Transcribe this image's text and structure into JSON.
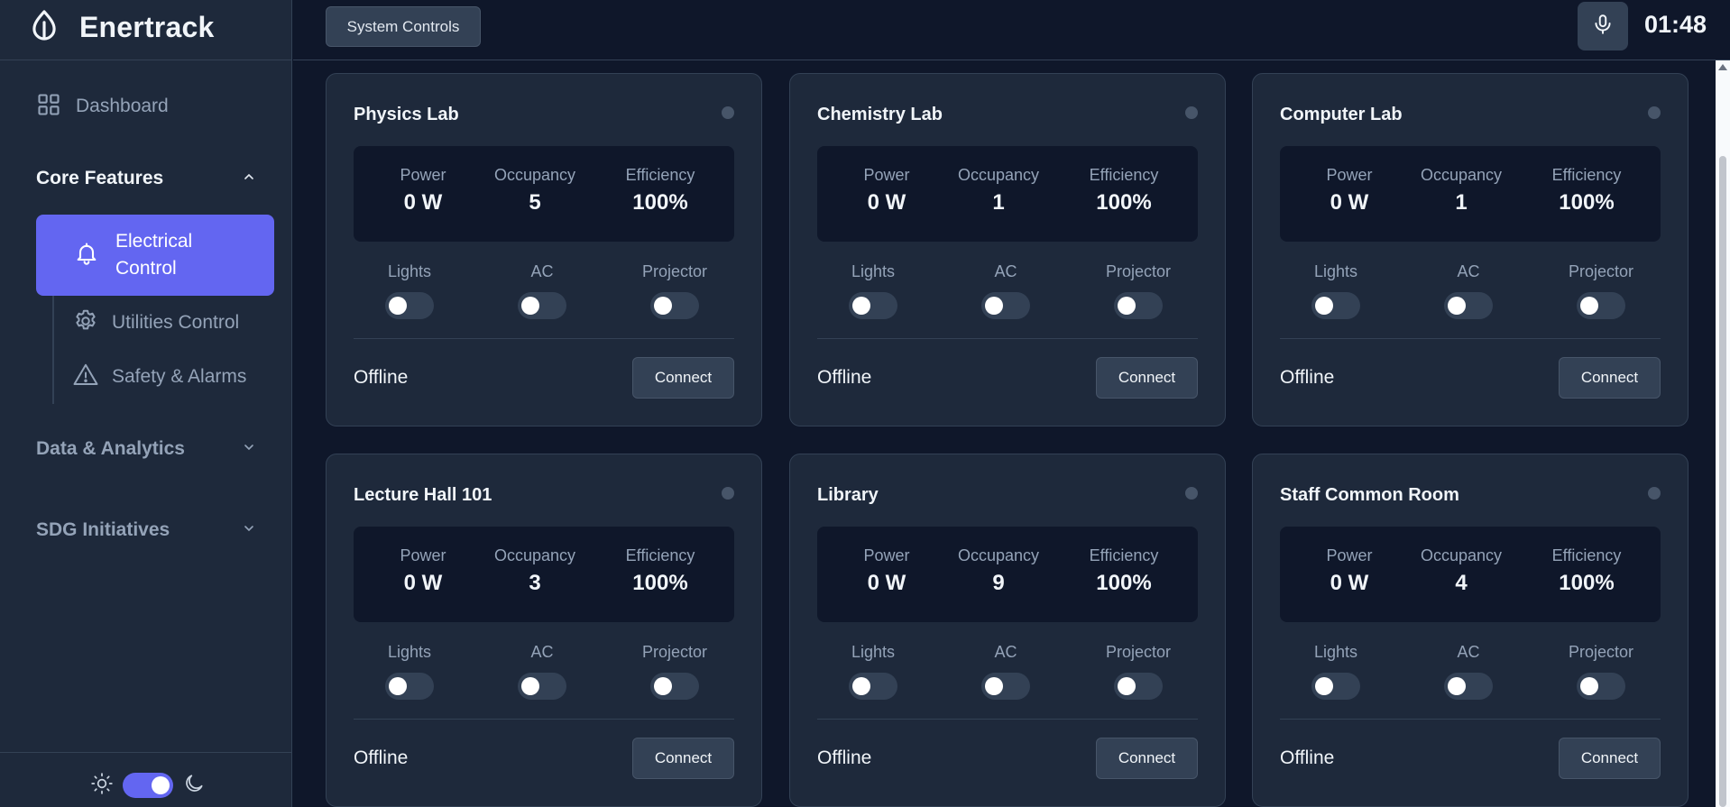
{
  "app": {
    "name": "Enertrack",
    "logo_icon": "leaf-drop-icon"
  },
  "sidebar": {
    "dashboard_label": "Dashboard",
    "core_features": {
      "label": "Core Features",
      "items": [
        {
          "label": "Electrical Control",
          "icon": "bell-icon",
          "active": true
        },
        {
          "label": "Utilities Control",
          "icon": "gear-icon"
        },
        {
          "label": "Safety & Alarms",
          "icon": "warning-icon"
        }
      ]
    },
    "data_analytics_label": "Data & Analytics",
    "sdg_label": "SDG Initiatives",
    "theme": {
      "dark_mode": true
    }
  },
  "topbar": {
    "system_controls_label": "System Controls",
    "clock": "01:48"
  },
  "labels": {
    "power": "Power",
    "occupancy": "Occupancy",
    "efficiency": "Efficiency",
    "lights": "Lights",
    "ac": "AC",
    "projector": "Projector",
    "connect": "Connect"
  },
  "rooms": [
    {
      "name": "Physics Lab",
      "power": "0 W",
      "occupancy": "5",
      "efficiency": "100%",
      "status": "Offline",
      "lights": false,
      "ac": false,
      "projector": false
    },
    {
      "name": "Chemistry Lab",
      "power": "0 W",
      "occupancy": "1",
      "efficiency": "100%",
      "status": "Offline",
      "lights": false,
      "ac": false,
      "projector": false
    },
    {
      "name": "Computer Lab",
      "power": "0 W",
      "occupancy": "1",
      "efficiency": "100%",
      "status": "Offline",
      "lights": false,
      "ac": false,
      "projector": false
    },
    {
      "name": "Lecture Hall 101",
      "power": "0 W",
      "occupancy": "3",
      "efficiency": "100%",
      "status": "Offline",
      "lights": false,
      "ac": false,
      "projector": false
    },
    {
      "name": "Library",
      "power": "0 W",
      "occupancy": "9",
      "efficiency": "100%",
      "status": "Offline",
      "lights": false,
      "ac": false,
      "projector": false
    },
    {
      "name": "Staff Common Room",
      "power": "0 W",
      "occupancy": "4",
      "efficiency": "100%",
      "status": "Offline",
      "lights": false,
      "ac": false,
      "projector": false
    }
  ],
  "colors": {
    "accent": "#6366f1",
    "background": "#0f172a",
    "card": "#1e293b",
    "border": "#334155",
    "muted_text": "#94a3b8"
  }
}
